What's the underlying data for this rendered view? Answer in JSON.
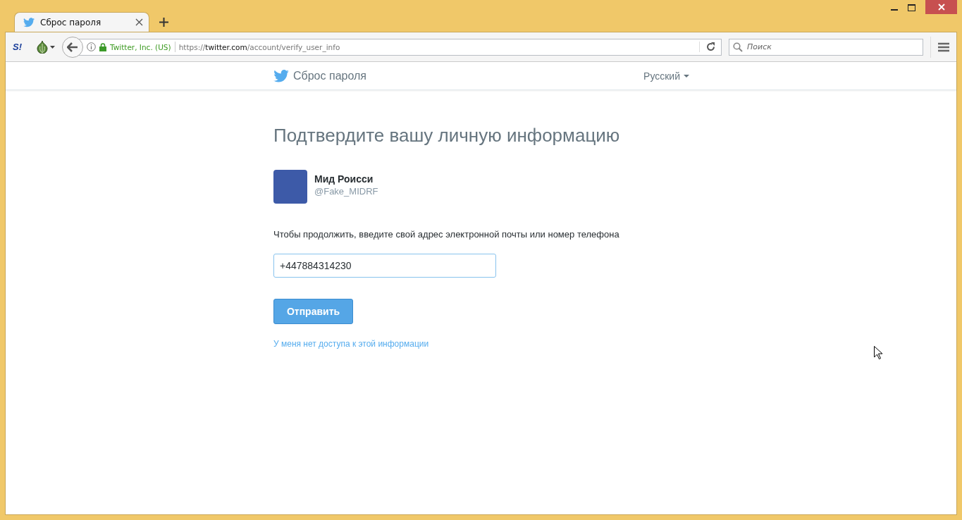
{
  "browser": {
    "tabs": [
      {
        "title": "Сброс пароля",
        "selected": true
      }
    ],
    "extension_badge": "S!",
    "identity": "Twitter, Inc. (US)",
    "url": {
      "scheme": "https://",
      "host": "twitter.com",
      "path": "/account/verify_user_info"
    },
    "search": {
      "placeholder": "Поиск"
    }
  },
  "header": {
    "title": "Сброс пароля",
    "language": "Русский"
  },
  "page": {
    "heading": "Подтвердите вашу личную информацию",
    "account": {
      "name": "Мид Роисси",
      "handle": "@Fake_MIDRF"
    },
    "instruction": "Чтобы продолжить, введите свой адрес электронной почты или номер телефона",
    "field": {
      "value": "+447884314230"
    },
    "submit": "Отправить",
    "help_link": "У меня нет доступа к этой информации"
  }
}
